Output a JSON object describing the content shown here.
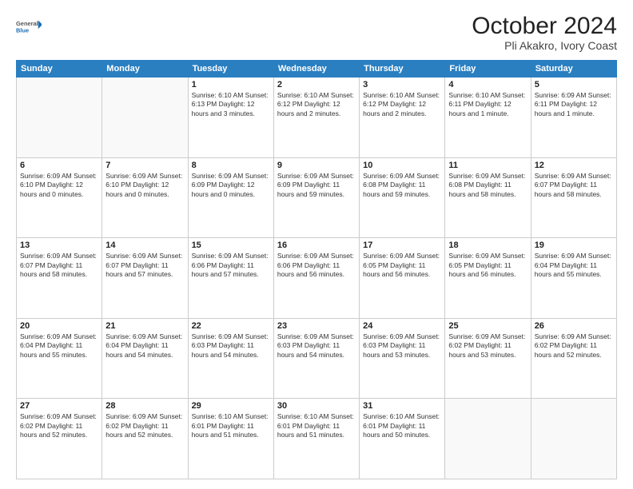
{
  "header": {
    "logo_line1": "General",
    "logo_line2": "Blue",
    "title": "October 2024",
    "subtitle": "Pli Akakro, Ivory Coast"
  },
  "days_of_week": [
    "Sunday",
    "Monday",
    "Tuesday",
    "Wednesday",
    "Thursday",
    "Friday",
    "Saturday"
  ],
  "weeks": [
    [
      {
        "day": "",
        "info": ""
      },
      {
        "day": "",
        "info": ""
      },
      {
        "day": "1",
        "info": "Sunrise: 6:10 AM\nSunset: 6:13 PM\nDaylight: 12 hours\nand 3 minutes."
      },
      {
        "day": "2",
        "info": "Sunrise: 6:10 AM\nSunset: 6:12 PM\nDaylight: 12 hours\nand 2 minutes."
      },
      {
        "day": "3",
        "info": "Sunrise: 6:10 AM\nSunset: 6:12 PM\nDaylight: 12 hours\nand 2 minutes."
      },
      {
        "day": "4",
        "info": "Sunrise: 6:10 AM\nSunset: 6:11 PM\nDaylight: 12 hours\nand 1 minute."
      },
      {
        "day": "5",
        "info": "Sunrise: 6:09 AM\nSunset: 6:11 PM\nDaylight: 12 hours\nand 1 minute."
      }
    ],
    [
      {
        "day": "6",
        "info": "Sunrise: 6:09 AM\nSunset: 6:10 PM\nDaylight: 12 hours\nand 0 minutes."
      },
      {
        "day": "7",
        "info": "Sunrise: 6:09 AM\nSunset: 6:10 PM\nDaylight: 12 hours\nand 0 minutes."
      },
      {
        "day": "8",
        "info": "Sunrise: 6:09 AM\nSunset: 6:09 PM\nDaylight: 12 hours\nand 0 minutes."
      },
      {
        "day": "9",
        "info": "Sunrise: 6:09 AM\nSunset: 6:09 PM\nDaylight: 11 hours\nand 59 minutes."
      },
      {
        "day": "10",
        "info": "Sunrise: 6:09 AM\nSunset: 6:08 PM\nDaylight: 11 hours\nand 59 minutes."
      },
      {
        "day": "11",
        "info": "Sunrise: 6:09 AM\nSunset: 6:08 PM\nDaylight: 11 hours\nand 58 minutes."
      },
      {
        "day": "12",
        "info": "Sunrise: 6:09 AM\nSunset: 6:07 PM\nDaylight: 11 hours\nand 58 minutes."
      }
    ],
    [
      {
        "day": "13",
        "info": "Sunrise: 6:09 AM\nSunset: 6:07 PM\nDaylight: 11 hours\nand 58 minutes."
      },
      {
        "day": "14",
        "info": "Sunrise: 6:09 AM\nSunset: 6:07 PM\nDaylight: 11 hours\nand 57 minutes."
      },
      {
        "day": "15",
        "info": "Sunrise: 6:09 AM\nSunset: 6:06 PM\nDaylight: 11 hours\nand 57 minutes."
      },
      {
        "day": "16",
        "info": "Sunrise: 6:09 AM\nSunset: 6:06 PM\nDaylight: 11 hours\nand 56 minutes."
      },
      {
        "day": "17",
        "info": "Sunrise: 6:09 AM\nSunset: 6:05 PM\nDaylight: 11 hours\nand 56 minutes."
      },
      {
        "day": "18",
        "info": "Sunrise: 6:09 AM\nSunset: 6:05 PM\nDaylight: 11 hours\nand 56 minutes."
      },
      {
        "day": "19",
        "info": "Sunrise: 6:09 AM\nSunset: 6:04 PM\nDaylight: 11 hours\nand 55 minutes."
      }
    ],
    [
      {
        "day": "20",
        "info": "Sunrise: 6:09 AM\nSunset: 6:04 PM\nDaylight: 11 hours\nand 55 minutes."
      },
      {
        "day": "21",
        "info": "Sunrise: 6:09 AM\nSunset: 6:04 PM\nDaylight: 11 hours\nand 54 minutes."
      },
      {
        "day": "22",
        "info": "Sunrise: 6:09 AM\nSunset: 6:03 PM\nDaylight: 11 hours\nand 54 minutes."
      },
      {
        "day": "23",
        "info": "Sunrise: 6:09 AM\nSunset: 6:03 PM\nDaylight: 11 hours\nand 54 minutes."
      },
      {
        "day": "24",
        "info": "Sunrise: 6:09 AM\nSunset: 6:03 PM\nDaylight: 11 hours\nand 53 minutes."
      },
      {
        "day": "25",
        "info": "Sunrise: 6:09 AM\nSunset: 6:02 PM\nDaylight: 11 hours\nand 53 minutes."
      },
      {
        "day": "26",
        "info": "Sunrise: 6:09 AM\nSunset: 6:02 PM\nDaylight: 11 hours\nand 52 minutes."
      }
    ],
    [
      {
        "day": "27",
        "info": "Sunrise: 6:09 AM\nSunset: 6:02 PM\nDaylight: 11 hours\nand 52 minutes."
      },
      {
        "day": "28",
        "info": "Sunrise: 6:09 AM\nSunset: 6:02 PM\nDaylight: 11 hours\nand 52 minutes."
      },
      {
        "day": "29",
        "info": "Sunrise: 6:10 AM\nSunset: 6:01 PM\nDaylight: 11 hours\nand 51 minutes."
      },
      {
        "day": "30",
        "info": "Sunrise: 6:10 AM\nSunset: 6:01 PM\nDaylight: 11 hours\nand 51 minutes."
      },
      {
        "day": "31",
        "info": "Sunrise: 6:10 AM\nSunset: 6:01 PM\nDaylight: 11 hours\nand 50 minutes."
      },
      {
        "day": "",
        "info": ""
      },
      {
        "day": "",
        "info": ""
      }
    ]
  ]
}
